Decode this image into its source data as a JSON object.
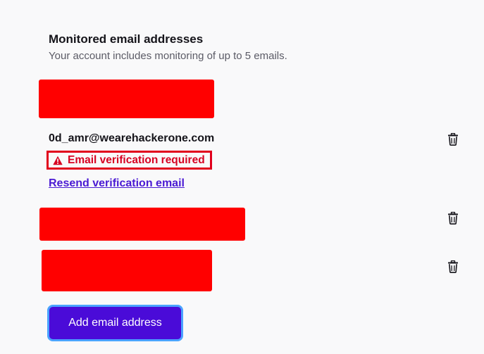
{
  "monitored_emails": {
    "title": "Monitored email addresses",
    "subtitle": "Your account includes monitoring of up to 5 emails.",
    "entries": [
      {
        "redacted": true
      },
      {
        "email": "0d_amr@wearehackerone.com",
        "status": "Email verification required",
        "resend_label": "Resend verification email",
        "status_icon": "warning-icon",
        "delete_icon": "trash-icon"
      },
      {
        "redacted": true,
        "delete_icon": "trash-icon"
      },
      {
        "redacted": true,
        "delete_icon": "trash-icon"
      }
    ],
    "add_button_label": "Add email address"
  },
  "colors": {
    "redaction": "#ff0000",
    "warning": "#d70022",
    "link": "#4a1ad3",
    "button": "#4a0bd8",
    "button_focus_ring": "#4aa3ff"
  }
}
